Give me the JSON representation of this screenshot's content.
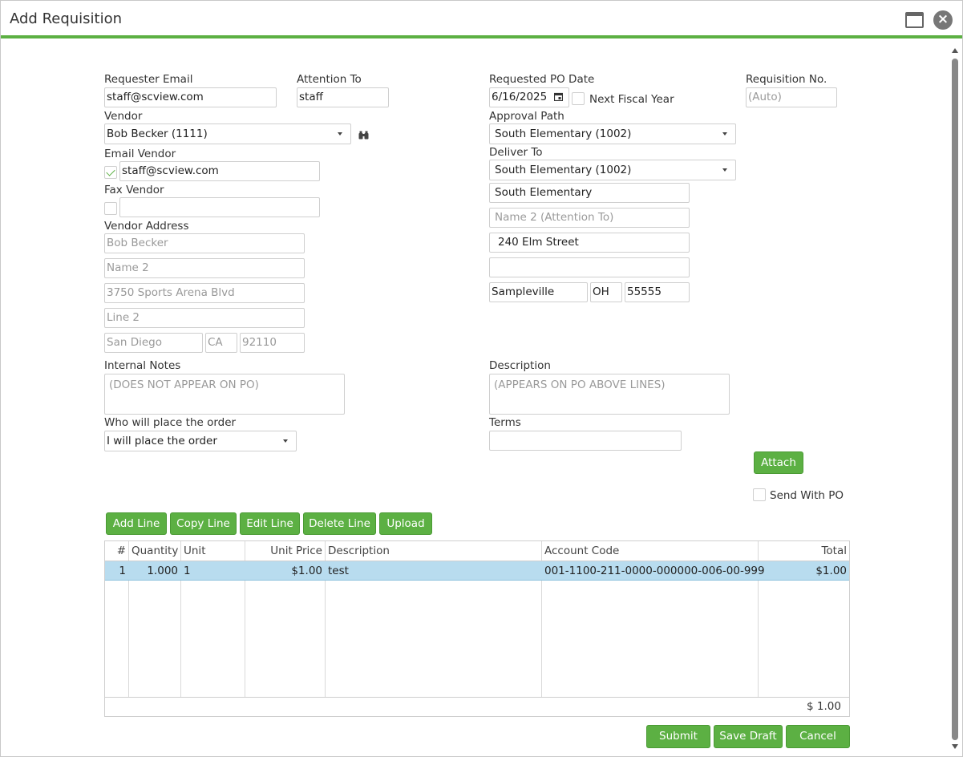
{
  "window": {
    "title": "Add Requisition"
  },
  "labels": {
    "requester_email": "Requester Email",
    "attention_to": "Attention To",
    "requested_po_date": "Requested PO Date",
    "requisition_no": "Requisition No.",
    "vendor": "Vendor",
    "approval_path": "Approval Path",
    "email_vendor": "Email Vendor",
    "deliver_to": "Deliver To",
    "fax_vendor": "Fax Vendor",
    "vendor_address": "Vendor Address",
    "next_fiscal_year": "Next Fiscal Year",
    "internal_notes": "Internal Notes",
    "description": "Description",
    "who_places_order": "Who will place the order",
    "terms": "Terms",
    "send_with_po": "Send With PO"
  },
  "fields": {
    "requester_email": "staff@scview.com",
    "attention_to": "staff",
    "requested_po_date": "6/16/2025",
    "requisition_no_placeholder": "(Auto)",
    "vendor": "Bob Becker (1111)",
    "approval_path": "South Elementary (1002)",
    "email_vendor": "staff@scview.com",
    "email_vendor_checked": true,
    "fax_vendor": "",
    "fax_vendor_checked": false,
    "next_fiscal_year_checked": false,
    "deliver_to": "South Elementary (1002)",
    "send_with_po_checked": false
  },
  "vendor_address": {
    "name": "Bob Becker",
    "name2_placeholder": "Name 2",
    "line1": "3750 Sports Arena Blvd",
    "line2_placeholder": "Line 2",
    "city": "San Diego",
    "state": "CA",
    "zip": "92110"
  },
  "deliver_address": {
    "name": "South Elementary",
    "name2_placeholder": "Name 2 (Attention To)",
    "line1": "240 Elm Street",
    "line2": "",
    "city": "Sampleville",
    "state": "OH",
    "zip": "55555"
  },
  "notes": {
    "internal_placeholder": "(DOES NOT APPEAR ON PO)",
    "description_placeholder": "(APPEARS ON PO ABOVE LINES)",
    "who_places_order": "I will place the order",
    "terms": ""
  },
  "buttons": {
    "attach": "Attach",
    "add_line": "Add Line",
    "copy_line": "Copy Line",
    "edit_line": "Edit Line",
    "delete_line": "Delete Line",
    "upload": "Upload",
    "submit": "Submit",
    "save_draft": "Save Draft",
    "cancel": "Cancel"
  },
  "grid": {
    "columns": [
      "#",
      "Quantity",
      "Unit",
      "Unit Price",
      "Description",
      "Account Code",
      "Total"
    ],
    "rows": [
      {
        "num": "1",
        "quantity": "1.000",
        "unit": "1",
        "unit_price": "$1.00",
        "description": "test",
        "account_code": "001-1100-211-0000-000000-006-00-999",
        "total": "$1.00"
      }
    ],
    "footer_total": "$ 1.00"
  },
  "icons": {
    "maximize": "maximize-icon",
    "close": "close-icon",
    "vendor_lookup": "binoculars-icon",
    "calendar": "calendar-icon"
  },
  "colors": {
    "accent": "#5cb043",
    "row_selected": "#b8dcef"
  }
}
